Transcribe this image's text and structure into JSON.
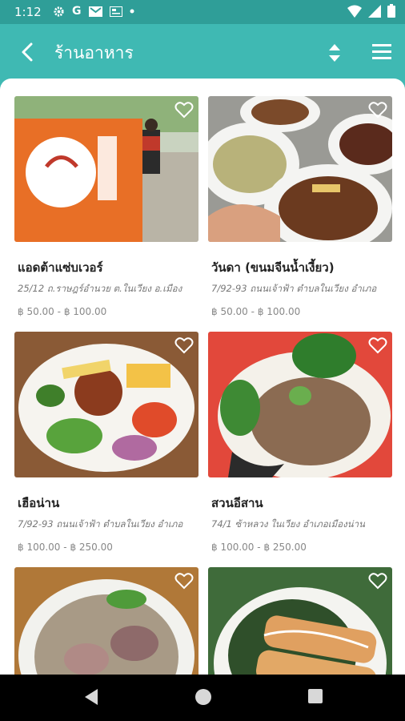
{
  "status_bar": {
    "time": "1:12",
    "left_icons": [
      "gear-icon",
      "google-icon",
      "gmail-icon",
      "news-icon",
      "dot-icon"
    ],
    "right_icons": [
      "wifi-icon",
      "signal-icon",
      "battery-icon"
    ]
  },
  "app_bar": {
    "title": "ร้านอาหาร",
    "back_icon": "back-arrow-icon",
    "sort_icon": "sort-icon",
    "menu_icon": "hamburger-menu-icon"
  },
  "colors": {
    "primary": "#3fb9b3",
    "primary_dark": "#2f9e98",
    "nav_bar": "#000000"
  },
  "restaurants": [
    {
      "name": "แอดต้าแซ่บเวอร์",
      "address": "25/12 ถ.ราษฎร์อำนวย ต.ในเวียง อ.เมือง",
      "price_min": "฿ 50.00",
      "price_sep": "-",
      "price_max": "฿ 100.00",
      "favorite_icon": "heart-outline-icon"
    },
    {
      "name": "วันดา (ขนมจีนน้ำเงี้ยว)",
      "address": "7/92-93 ถนนเจ้าฟ้า ตำบลในเวียง อำเภอ",
      "price_min": "฿ 50.00",
      "price_sep": "-",
      "price_max": "฿ 100.00",
      "favorite_icon": "heart-outline-icon"
    },
    {
      "name": "เฮือน่าน",
      "address": "7/92-93 ถนนเจ้าฟ้า ตำบลในเวียง อำเภอ",
      "price_min": "฿ 100.00",
      "price_sep": "-",
      "price_max": "฿ 250.00",
      "favorite_icon": "heart-outline-icon"
    },
    {
      "name": "สวนอีสาน",
      "address": "74/1 ซ้าหลวง ในเวียง อำเภอเมืองน่าน",
      "price_min": "฿ 100.00",
      "price_sep": "-",
      "price_max": "฿ 250.00",
      "favorite_icon": "heart-outline-icon"
    },
    {
      "name": "",
      "address": "",
      "price_min": "",
      "price_sep": "",
      "price_max": "",
      "favorite_icon": "heart-outline-icon"
    },
    {
      "name": "",
      "address": "",
      "price_min": "",
      "price_sep": "",
      "price_max": "",
      "favorite_icon": "heart-outline-icon"
    }
  ],
  "nav_bar": {
    "back_icon": "nav-back-icon",
    "home_icon": "nav-home-icon",
    "recents_icon": "nav-recents-icon"
  }
}
